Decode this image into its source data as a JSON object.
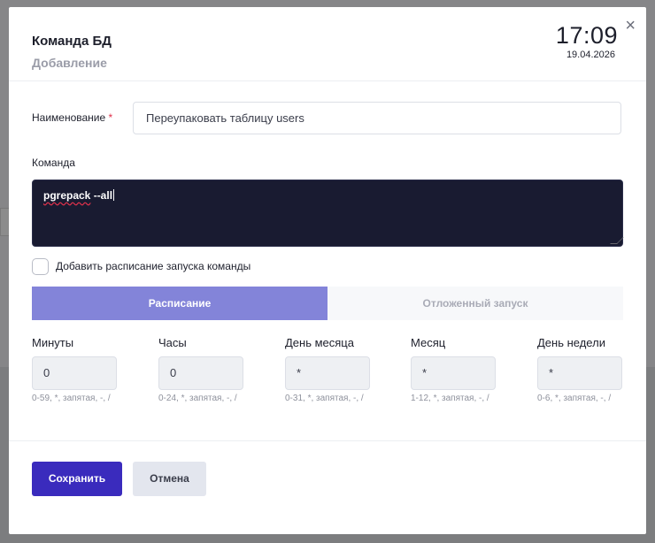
{
  "modal": {
    "title": "Команда БД",
    "subtitle": "Добавление",
    "time": "17:09",
    "date": "19.04.2026",
    "close_icon": "×"
  },
  "form": {
    "name_label": "Наименование",
    "required_mark": "*",
    "name_value": "Переупаковать таблицу users",
    "command_label": "Команда",
    "command_word": "pgrepack",
    "command_rest": " --all",
    "schedule_checkbox_label": "Добавить расписание запуска команды",
    "schedule_checked": false
  },
  "tabs": [
    {
      "label": "Расписание",
      "active": true
    },
    {
      "label": "Отложенный запуск",
      "active": false
    }
  ],
  "schedule_fields": [
    {
      "label": "Минуты",
      "value": "0",
      "hint": "0-59, *, запятая, -, /"
    },
    {
      "label": "Часы",
      "value": "0",
      "hint": "0-24, *, запятая, -, /"
    },
    {
      "label": "День месяца",
      "value": "*",
      "hint": "0-31, *, запятая, -, /"
    },
    {
      "label": "Месяц",
      "value": "*",
      "hint": "1-12, *, запятая, -, /"
    },
    {
      "label": "День недели",
      "value": "*",
      "hint": "0-6, *, запятая, -, /"
    }
  ],
  "buttons": {
    "save": "Сохранить",
    "cancel": "Отмена"
  },
  "colors": {
    "save_button": "#3a2bbd",
    "active_tab": "#8384d9",
    "command_bg": "#191b31",
    "required": "#e0314b"
  }
}
